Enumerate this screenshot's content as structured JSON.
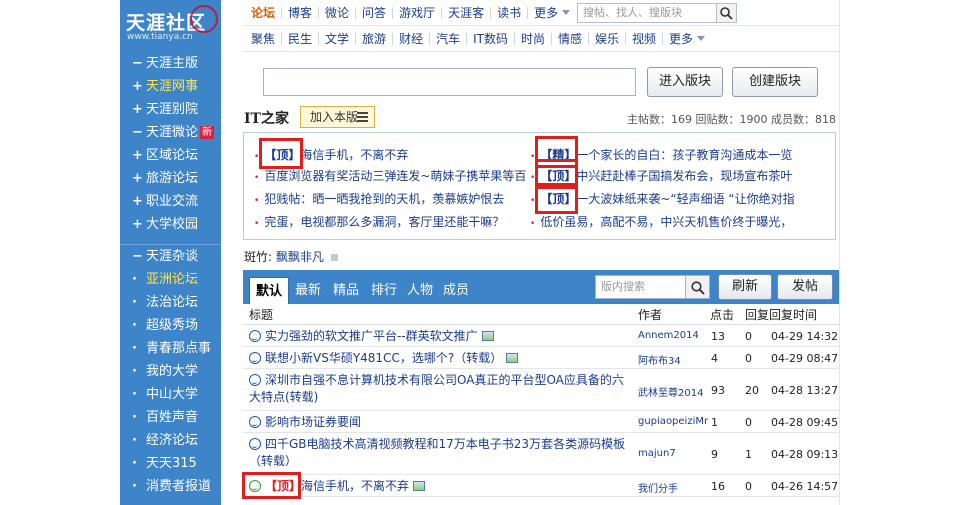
{
  "logo": {
    "text": "天涯社区",
    "url": "www.tianya.cn"
  },
  "sidebar": {
    "group1": [
      {
        "mark": "−",
        "label": "天涯主版",
        "hl": false
      },
      {
        "mark": "+",
        "label": "天涯网事",
        "hl": true
      },
      {
        "mark": "+",
        "label": "天涯别院",
        "hl": false
      },
      {
        "mark": "−",
        "label": "天涯微论",
        "hl": false,
        "badge": "新"
      },
      {
        "mark": "+",
        "label": "区域论坛",
        "hl": false
      },
      {
        "mark": "+",
        "label": "旅游论坛",
        "hl": false
      },
      {
        "mark": "+",
        "label": "职业交流",
        "hl": false
      },
      {
        "mark": "+",
        "label": "大学校园",
        "hl": false
      }
    ],
    "group2": [
      {
        "mark": "−",
        "label": "天涯杂谈",
        "hl": false
      },
      {
        "mark": "·",
        "label": "亚洲论坛",
        "hl": true
      },
      {
        "mark": "·",
        "label": "法治论坛",
        "hl": false
      },
      {
        "mark": "·",
        "label": "超级秀场",
        "hl": false
      },
      {
        "mark": "·",
        "label": "青春那点事",
        "hl": false
      },
      {
        "mark": "·",
        "label": "我的大学",
        "hl": false
      },
      {
        "mark": "·",
        "label": "中山大学",
        "hl": false
      },
      {
        "mark": "·",
        "label": "百姓声音",
        "hl": false
      },
      {
        "mark": "·",
        "label": "经济论坛",
        "hl": false
      },
      {
        "mark": "·",
        "label": "天天315",
        "hl": false
      },
      {
        "mark": "·",
        "label": "消费者报道",
        "hl": false
      }
    ]
  },
  "topnav": {
    "row1": [
      "论坛",
      "博客",
      "微论",
      "问答",
      "游戏厅",
      "天涯客",
      "读书",
      "更多"
    ],
    "row2": [
      "聚焦",
      "民生",
      "文学",
      "旅游",
      "财经",
      "汽车",
      "IT数码",
      "时尚",
      "情感",
      "娱乐",
      "视频",
      "更多"
    ],
    "search_placeholder": "搜帖、找人、搜版块"
  },
  "forum": {
    "enter_label": "进入版块",
    "create_label": "创建版块",
    "board_title": "IT之家",
    "join_label": "加入本版",
    "stats": "主帖数：169  回贴数：1900  成员数：818"
  },
  "pinned": {
    "left": [
      {
        "tag": "【顶】",
        "text": "海信手机，不离不弃"
      },
      {
        "tag": "",
        "text": "百度浏览器有奖活动三弹连发~萌妹子携苹果等百"
      },
      {
        "tag": "",
        "text": "犯贱帖：晒一晒我抢到的天机，羡慕嫉妒恨去"
      },
      {
        "tag": "",
        "text": "完蛋，电视都那么多漏洞，客厅里还能干嘛？"
      }
    ],
    "right": [
      {
        "tag": "【精】",
        "text": "一个家长的自白：孩子教育沟通成本一览"
      },
      {
        "tag": "【顶】",
        "text": "中兴赶赴棒子国搞发布会，现场宣布茶叶"
      },
      {
        "tag": "【顶】",
        "text": "一大波妹纸来袭~“轻声细语 “让你绝对指"
      },
      {
        "tag": "",
        "text": "低价虽易，高配不易，中兴天机售价终于曝光，"
      }
    ]
  },
  "moderators": {
    "label": "斑竹:",
    "name": "飘飘非凡"
  },
  "tabs": [
    "默认",
    "最新",
    "精品",
    "排行",
    "人物",
    "成员"
  ],
  "toolbar": {
    "search_placeholder": "版内搜索",
    "refresh_label": "刷新",
    "post_label": "发帖"
  },
  "table": {
    "headers": {
      "title": "标题",
      "author": "作者",
      "clicks": "点击",
      "replies": "回复",
      "reply_time": "回复时间"
    },
    "rows": [
      {
        "title": "实力强劲的软文推广平台--群英软文推广",
        "img": true,
        "author": "Annem2014",
        "clicks": "13",
        "replies": "0",
        "time": "04-29 14:32",
        "top": false,
        "lines": 1
      },
      {
        "title": "联想小新VS华硕Y481CC，选哪个?（转载）",
        "img": true,
        "author": "阿布布34",
        "clicks": "4",
        "replies": "0",
        "time": "04-29 08:47",
        "top": false,
        "lines": 1
      },
      {
        "title": "深圳市自强不息计算机技术有限公司OA真正的平台型OA应具备的六大特点(转载)",
        "img": false,
        "author": "武林至尊2014",
        "clicks": "93",
        "replies": "20",
        "time": "04-28 13:27",
        "top": false,
        "lines": 2
      },
      {
        "title": "影响市场证券要闻",
        "img": false,
        "author": "gupiaopeiziMr",
        "clicks": "1",
        "replies": "0",
        "time": "04-28 09:45",
        "top": false,
        "lines": 1
      },
      {
        "title": "四千GB电脑技术高清视频教程和17万本电子书23万套各类源码模板（转载）",
        "img": false,
        "author": "majun7",
        "clicks": "9",
        "replies": "1",
        "time": "04-28 09:13",
        "top": false,
        "lines": 2
      },
      {
        "title": "海信手机，不离不弃",
        "img": true,
        "author": "我们分手",
        "clicks": "16",
        "replies": "0",
        "time": "04-26 14:57",
        "top": true,
        "tag": "【顶】",
        "lines": 1
      }
    ]
  },
  "colors": {
    "accent": "#3e84c8",
    "highlight_frame": "#e01e1e",
    "link": "#1a3c8c",
    "active_nav": "#e45a00"
  }
}
